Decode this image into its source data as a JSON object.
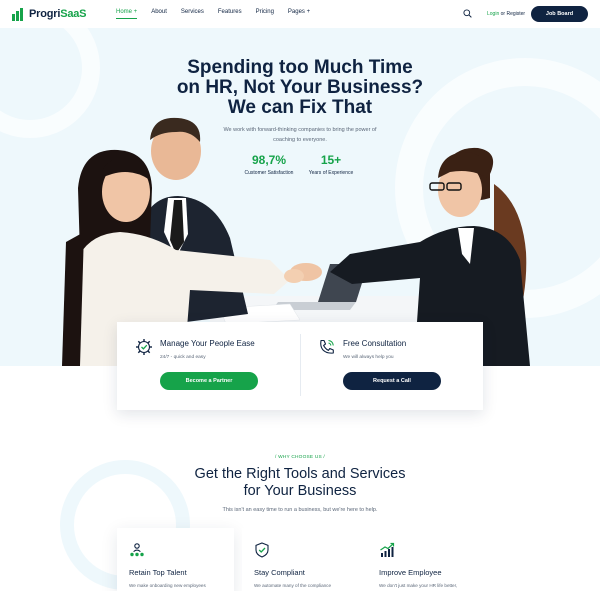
{
  "header": {
    "logo_prefix": "Progri",
    "logo_suffix": "SaaS",
    "nav": [
      {
        "label": "Home +"
      },
      {
        "label": "About"
      },
      {
        "label": "Services"
      },
      {
        "label": "Features"
      },
      {
        "label": "Pricing"
      },
      {
        "label": "Pages +"
      }
    ],
    "login_label": "Login",
    "or_label": "or",
    "register_label": "Register",
    "job_board_label": "Job Board"
  },
  "hero": {
    "title_lines": [
      "Spending too Much Time",
      "on HR, Not Your Business?",
      "We can Fix That"
    ],
    "subtitle_line1": "We work with forward-thinking companies to bring the power of",
    "subtitle_line2": "coaching to everyone.",
    "stats": [
      {
        "value": "98,7%",
        "label": "Customer Satisfaction"
      },
      {
        "value": "15+",
        "label": "Years of Experience"
      }
    ]
  },
  "services": [
    {
      "title": "Manage Your People Ease",
      "desc": "24/7 - quick and easy",
      "button": "Become a Partner",
      "button_color": "#16a34a",
      "icon": "settings-check-icon"
    },
    {
      "title": "Free Consultation",
      "desc": "We will always help you",
      "button": "Request a Call",
      "button_color": "#0f2341",
      "icon": "phone-icon"
    }
  ],
  "why": {
    "kicker": "/   WHY CHOOSE US   /",
    "title_lines": [
      "Get the Right Tools and Services",
      "for Your Business"
    ],
    "subtitle": "This isn't an easy time to run a business, but we're here to help.",
    "features": [
      {
        "title": "Retain Top Talent",
        "desc": "We make onboarding new employees",
        "icon": "team-icon"
      },
      {
        "title": "Stay Compliant",
        "desc": "We automate many of the compliance",
        "icon": "shield-check-icon"
      },
      {
        "title": "Improve Employee",
        "desc": "We don't just make your HR life better,",
        "icon": "growth-chart-icon"
      }
    ]
  },
  "colors": {
    "brand": "#16a34a",
    "navy": "#0f2341",
    "hero_bg": "#eef8fc"
  }
}
